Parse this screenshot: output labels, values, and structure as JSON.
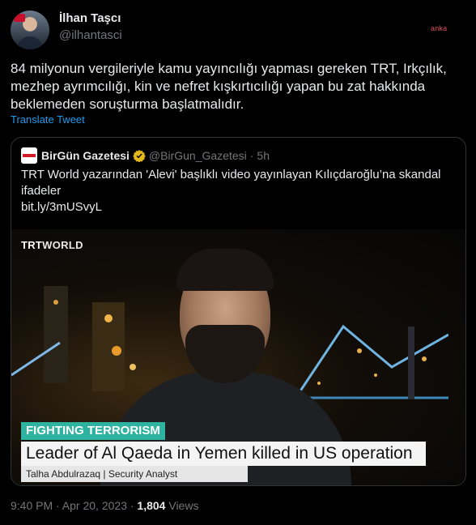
{
  "author": {
    "name": "İlhan Taşcı",
    "handle": "@ilhantasci"
  },
  "watermark": "anka",
  "tweet": {
    "text": "84 milyonun vergileriyle kamu yayıncılığı yapması gereken TRT, Irkçılık, mezhep ayrımcılığı, kin ve nefret kışkırtıcılığı yapan bu zat hakkında beklemeden soruşturma başlatmalıdır.",
    "translate_label": "Translate Tweet"
  },
  "quote": {
    "name": "BirGün Gazetesi",
    "handle": "@BirGun_Gazetesi",
    "separator": "·",
    "age": "5h",
    "text": "TRT World yazarından 'Alevi' başlıklı video yayınlayan Kılıçdaroğlu’na skandal ifadeler",
    "link": "bit.ly/3mUSvyL",
    "media": {
      "channel_logo_prefix": "TRT",
      "channel_logo_suffix": "WORLD",
      "segment_tag": "FIGHTING TERRORISM",
      "headline": "Leader of Al Qaeda in Yemen killed in US operation",
      "caption": "Talha Abdulrazaq | Security Analyst"
    }
  },
  "meta": {
    "time": "9:40 PM · Apr 20, 2023 ·",
    "views_count": "1,804",
    "views_label": "Views"
  },
  "colors": {
    "background": "#000000",
    "link": "#1d9bf0",
    "muted": "#71767b",
    "tag": "#2fb3a1"
  }
}
